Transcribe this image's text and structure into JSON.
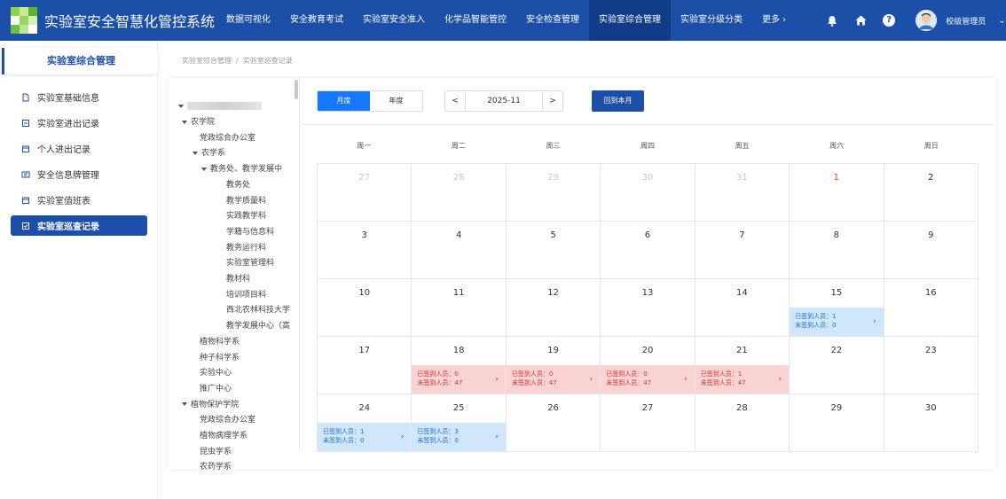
{
  "app": {
    "title": "实验室安全智慧化管控系统",
    "logo_colors": [
      "#8fd34d",
      "#c9e89a",
      "#5fb52a",
      "#ffffff",
      "#9ad45e",
      "#d7eeb7",
      "#70c13d",
      "#bfe48f",
      "#ffffff"
    ]
  },
  "nav": {
    "items": [
      {
        "label": "数据可视化",
        "active": false
      },
      {
        "label": "安全教育考试",
        "active": false
      },
      {
        "label": "实验室安全准入",
        "active": false
      },
      {
        "label": "化学品智能管控",
        "active": false
      },
      {
        "label": "安全检查管理",
        "active": false
      },
      {
        "label": "实验室综合管理",
        "active": true
      },
      {
        "label": "实验室分级分类",
        "active": false
      },
      {
        "label": "更多 ›",
        "active": false
      }
    ]
  },
  "user": {
    "name": "校级管理员",
    "caret": "⌄"
  },
  "sidebar": {
    "header": "实验室综合管理",
    "items": [
      {
        "label": "实验室基础信息",
        "icon": "document-icon",
        "active": false
      },
      {
        "label": "实验室进出记录",
        "icon": "entry-log-icon",
        "active": false
      },
      {
        "label": "个人进出记录",
        "icon": "calendar-icon",
        "active": false
      },
      {
        "label": "安全信息牌管理",
        "icon": "board-icon",
        "active": false
      },
      {
        "label": "实验室值班表",
        "icon": "calendar-icon",
        "active": false
      },
      {
        "label": "实验室巡查记录",
        "icon": "checklist-icon",
        "active": true
      }
    ]
  },
  "breadcrumb": {
    "parent": "实验室综合管理",
    "separator": "/",
    "current": "实验室巡查记录"
  },
  "tree": {
    "nodes": [
      {
        "label": "农学院",
        "level": 1,
        "expanded": true
      },
      {
        "label": "党政综合办公室",
        "level": 2,
        "expanded": false
      },
      {
        "label": "农学系",
        "level": 2,
        "expanded": true
      },
      {
        "label": "教务处、教学发展中",
        "level": 3,
        "expanded": true
      },
      {
        "label": "教务处",
        "level": 4,
        "expanded": false
      },
      {
        "label": "教学质量科",
        "level": 4,
        "expanded": false
      },
      {
        "label": "实践教学科",
        "level": 4,
        "expanded": false
      },
      {
        "label": "学籍与信息科",
        "level": 4,
        "expanded": false
      },
      {
        "label": "教务运行科",
        "level": 4,
        "expanded": false
      },
      {
        "label": "实验室管理科",
        "level": 4,
        "expanded": false
      },
      {
        "label": "教材科",
        "level": 4,
        "expanded": false
      },
      {
        "label": "培训项目科",
        "level": 4,
        "expanded": false
      },
      {
        "label": "西北农林科技大学",
        "level": 4,
        "expanded": false
      },
      {
        "label": "教学发展中心（高",
        "level": 4,
        "expanded": false
      },
      {
        "label": "植物科学系",
        "level": 2,
        "expanded": false
      },
      {
        "label": "种子科学系",
        "level": 2,
        "expanded": false
      },
      {
        "label": "实验中心",
        "level": 2,
        "expanded": false
      },
      {
        "label": "推广中心",
        "level": 2,
        "expanded": false
      },
      {
        "label": "植物保护学院",
        "level": 1,
        "expanded": true
      },
      {
        "label": "党政综合办公室",
        "level": 2,
        "expanded": false
      },
      {
        "label": "植物病理学系",
        "level": 2,
        "expanded": false
      },
      {
        "label": "昆虫学系",
        "level": 2,
        "expanded": false
      },
      {
        "label": "农药学系",
        "level": 2,
        "expanded": false
      }
    ]
  },
  "calendar": {
    "view_month_label": "月度",
    "view_year_label": "年度",
    "active_view": "month",
    "prev": "<",
    "next": ">",
    "month_value": "2025-11",
    "current_month_button": "回到本月",
    "weekdays": [
      "周一",
      "周二",
      "周三",
      "周四",
      "周五",
      "周六",
      "周日"
    ],
    "signed_label": "已签到人员：",
    "unsigned_label": "未签到人员：",
    "colors": {
      "blue_bg": "#cfe6fb",
      "blue_text": "#1b6fd6",
      "red_bg": "#fbd3d3",
      "red_text": "#d9302b",
      "today": "#e0421f"
    },
    "days": [
      {
        "day": "27",
        "other": true
      },
      {
        "day": "28",
        "other": true
      },
      {
        "day": "29",
        "other": true
      },
      {
        "day": "30",
        "other": true
      },
      {
        "day": "31",
        "other": true
      },
      {
        "day": "1",
        "today": true
      },
      {
        "day": "2"
      },
      {
        "day": "3"
      },
      {
        "day": "4"
      },
      {
        "day": "5"
      },
      {
        "day": "6"
      },
      {
        "day": "7"
      },
      {
        "day": "8"
      },
      {
        "day": "9"
      },
      {
        "day": "10"
      },
      {
        "day": "11"
      },
      {
        "day": "12"
      },
      {
        "day": "13"
      },
      {
        "day": "14"
      },
      {
        "day": "15",
        "status": "blue",
        "signed": "1",
        "unsigned": "0"
      },
      {
        "day": "16"
      },
      {
        "day": "17"
      },
      {
        "day": "18",
        "status": "red",
        "signed": "0",
        "unsigned": "47"
      },
      {
        "day": "19",
        "status": "red",
        "signed": "0",
        "unsigned": "47"
      },
      {
        "day": "20",
        "status": "red",
        "signed": "0",
        "unsigned": "47"
      },
      {
        "day": "21",
        "status": "red",
        "signed": "1",
        "unsigned": "47"
      },
      {
        "day": "22"
      },
      {
        "day": "23"
      },
      {
        "day": "24",
        "status": "blue",
        "signed": "1",
        "unsigned": "0"
      },
      {
        "day": "25",
        "status": "blue",
        "signed": "3",
        "unsigned": "0"
      },
      {
        "day": "26"
      },
      {
        "day": "27"
      },
      {
        "day": "28"
      },
      {
        "day": "29"
      },
      {
        "day": "30"
      }
    ]
  }
}
